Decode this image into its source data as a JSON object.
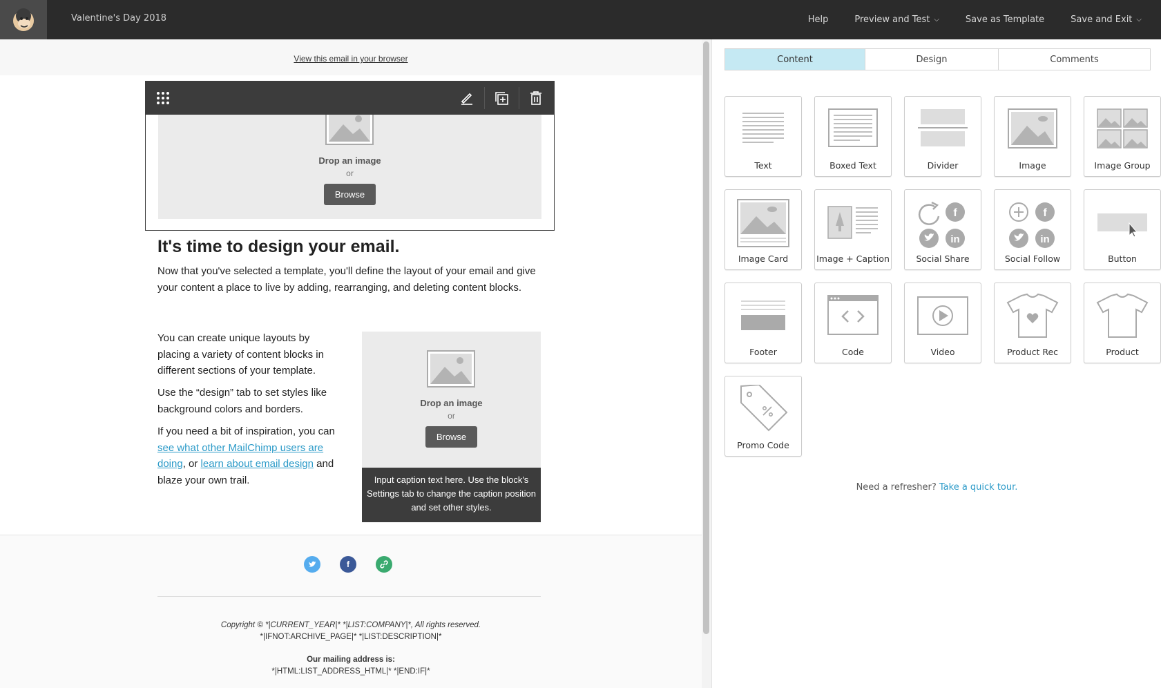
{
  "header": {
    "campaign_title": "Valentine's Day 2018",
    "nav": {
      "help": "Help",
      "preview": "Preview and Test",
      "save_template": "Save as Template",
      "save_exit": "Save and Exit"
    }
  },
  "email": {
    "view_in_browser": "View this email in your browser",
    "image_block": {
      "drop": "Drop an image",
      "or": "or",
      "browse": "Browse"
    },
    "heading": "It's time to design your email.",
    "intro": "Now that you've selected a template, you'll define the layout of your email and give your content a place to live by adding, rearranging, and deleting content blocks.",
    "col_p1": "You can create unique layouts by placing a variety of content blocks in different sections of your template.",
    "col_p2": "Use the “design” tab to set styles like background colors and borders.",
    "col_p3_a": "If you need a bit of inspiration, you can ",
    "col_p3_link1": "see what other MailChimp users are doing",
    "col_p3_b": ", or ",
    "col_p3_link2": "learn about email design",
    "col_p3_c": " and blaze your own trail.",
    "image_block2": {
      "drop": "Drop an image",
      "or": "or",
      "browse": "Browse"
    },
    "caption": "Input caption text here. Use the block's Settings tab to change the caption position and set other styles.",
    "footer": {
      "copyright": "Copyright © *|CURRENT_YEAR|* *|LIST:COMPANY|*, All rights reserved.",
      "archive": "*|IFNOT:ARCHIVE_PAGE|* *|LIST:DESCRIPTION|*",
      "mailing_label": "Our mailing address is:",
      "mailing_value": "*|HTML:LIST_ADDRESS_HTML|* *|END:IF|*"
    }
  },
  "panel": {
    "tabs": [
      "Content",
      "Design",
      "Comments"
    ],
    "blocks": [
      "Text",
      "Boxed Text",
      "Divider",
      "Image",
      "Image Group",
      "Image Card",
      "Image + Caption",
      "Social Share",
      "Social Follow",
      "Button",
      "Footer",
      "Code",
      "Video",
      "Product Rec",
      "Product",
      "Promo Code"
    ],
    "refresher": "Need a refresher?",
    "tour_link": "Take a quick tour."
  },
  "colors": {
    "accent": "#2b9ac8",
    "active_tab": "#c5e9f3",
    "twitter": "#55acee",
    "facebook": "#3b5998",
    "link": "#3aaa6f"
  }
}
